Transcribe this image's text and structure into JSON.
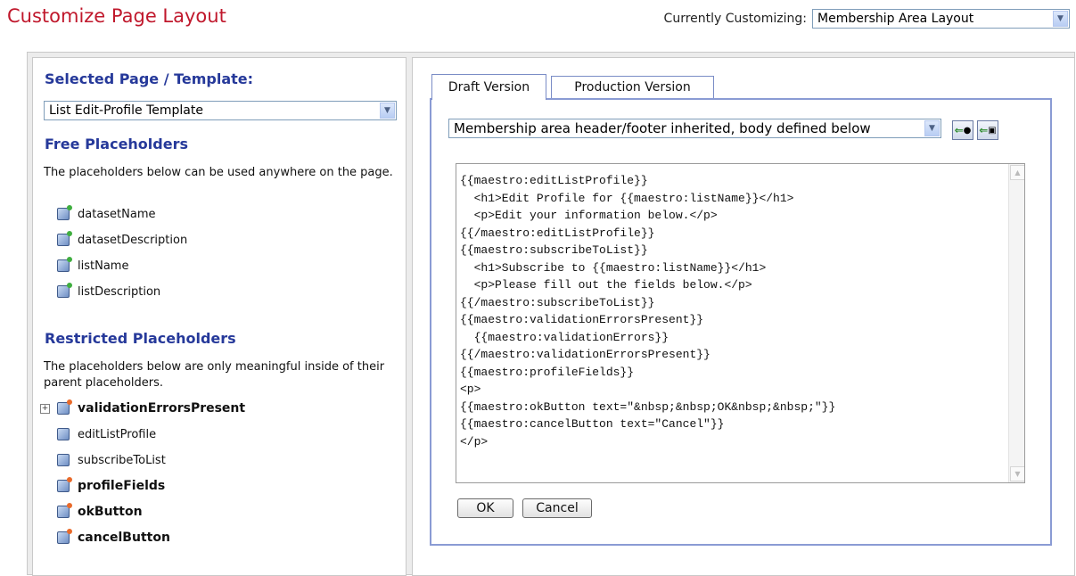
{
  "header": {
    "title": "Customize Page Layout",
    "customizing_label": "Currently Customizing:",
    "customizing_value": "Membership Area Layout"
  },
  "left": {
    "selected_heading": "Selected Page / Template:",
    "selected_value": "List Edit-Profile Template",
    "free_heading": "Free Placeholders",
    "free_desc": "The placeholders below can be used anywhere on the page.",
    "free_items": [
      "datasetName",
      "datasetDescription",
      "listName",
      "listDescription"
    ],
    "restricted_heading": "Restricted Placeholders",
    "restricted_desc": "The placeholders below are only meaningful inside of their parent placeholders.",
    "restricted_items": [
      "validationErrorsPresent",
      "editListProfile",
      "subscribeToList",
      "profileFields",
      "okButton",
      "cancelButton"
    ]
  },
  "right": {
    "tabs": [
      "Draft Version",
      "Production Version"
    ],
    "layout_mode": "Membership area header/footer inherited, body defined below",
    "editor_text": "{{maestro:editListProfile}}\n  <h1>Edit Profile for {{maestro:listName}}</h1>\n  <p>Edit your information below.</p>\n{{/maestro:editListProfile}}\n{{maestro:subscribeToList}}\n  <h1>Subscribe to {{maestro:listName}}</h1>\n  <p>Please fill out the fields below.</p>\n{{/maestro:subscribeToList}}\n{{maestro:validationErrorsPresent}}\n  {{maestro:validationErrors}}\n{{/maestro:validationErrorsPresent}}\n{{maestro:profileFields}}\n<p>\n{{maestro:okButton text=\"&nbsp;&nbsp;OK&nbsp;&nbsp;\"}}\n{{maestro:cancelButton text=\"Cancel\"}}\n</p>",
    "ok_label": "OK",
    "cancel_label": "Cancel"
  },
  "colors": {
    "title": "#c0182c",
    "heading": "#26399a",
    "tab_border": "#8a9bd4"
  },
  "icons": [
    "chevron-down-icon",
    "placeholder-icon",
    "expand-plus-icon",
    "insert-link-icon",
    "insert-template-icon"
  ]
}
